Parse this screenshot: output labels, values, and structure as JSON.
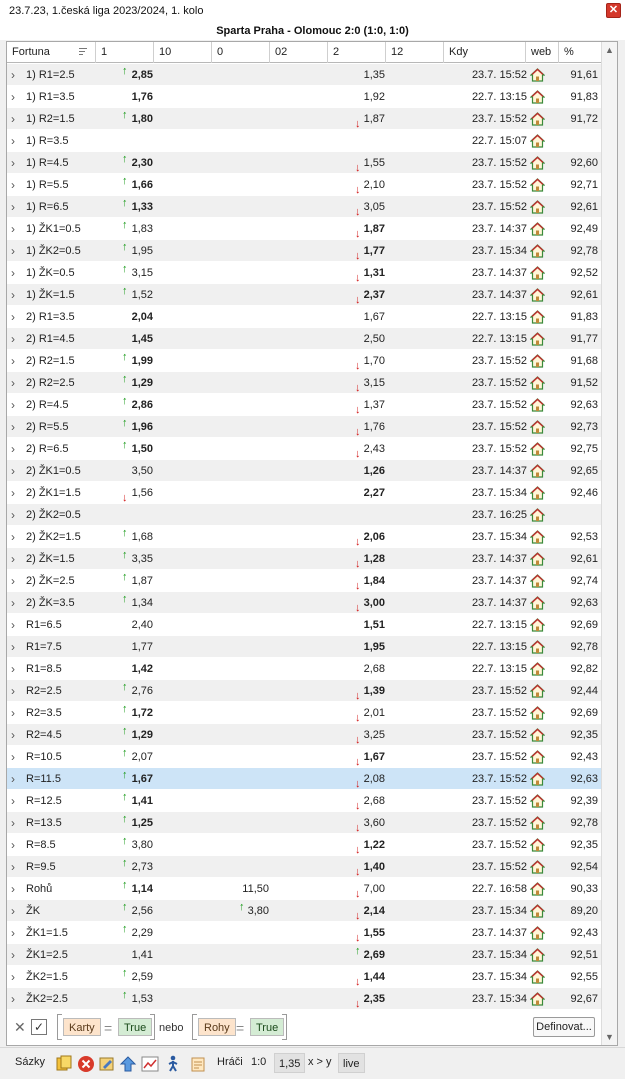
{
  "window": {
    "title": "23.7.23, 1.česká liga 2023/2024, 1. kolo",
    "close_label": "✕"
  },
  "match": {
    "title": "Sparta Praha - Olomouc 2:0 (1:0, 1:0)"
  },
  "columns": [
    "Fortuna",
    "1",
    "10",
    "0",
    "02",
    "2",
    "12",
    "Kdy",
    "web",
    "%"
  ],
  "rows": [
    {
      "name": "1) R1=2.5",
      "o1": "2,85",
      "o1b": true,
      "o1a": "up",
      "o10": "",
      "o10a": "",
      "o2": "1,35",
      "o2b": false,
      "o2a": "",
      "kdy": "23.7. 15:52",
      "pct": "91,61"
    },
    {
      "name": "1) R1=3.5",
      "o1": "1,76",
      "o1b": true,
      "o1a": "",
      "o10": "",
      "o10a": "",
      "o2": "1,92",
      "o2b": false,
      "o2a": "",
      "kdy": "22.7. 13:15",
      "pct": "91,83"
    },
    {
      "name": "1) R2=1.5",
      "o1": "1,80",
      "o1b": true,
      "o1a": "up",
      "o10": "",
      "o10a": "",
      "o2": "1,87",
      "o2b": false,
      "o2a": "down",
      "kdy": "23.7. 15:52",
      "pct": "91,72"
    },
    {
      "name": "1) R=3.5",
      "o1": "",
      "o1b": false,
      "o1a": "",
      "o10": "",
      "o10a": "",
      "o2": "",
      "o2b": false,
      "o2a": "",
      "kdy": "22.7. 15:07",
      "pct": ""
    },
    {
      "name": "1) R=4.5",
      "o1": "2,30",
      "o1b": true,
      "o1a": "up",
      "o10": "",
      "o10a": "",
      "o2": "1,55",
      "o2b": false,
      "o2a": "down",
      "kdy": "23.7. 15:52",
      "pct": "92,60"
    },
    {
      "name": "1) R=5.5",
      "o1": "1,66",
      "o1b": true,
      "o1a": "up",
      "o10": "",
      "o10a": "",
      "o2": "2,10",
      "o2b": false,
      "o2a": "down",
      "kdy": "23.7. 15:52",
      "pct": "92,71"
    },
    {
      "name": "1) R=6.5",
      "o1": "1,33",
      "o1b": true,
      "o1a": "up",
      "o10": "",
      "o10a": "",
      "o2": "3,05",
      "o2b": false,
      "o2a": "down",
      "kdy": "23.7. 15:52",
      "pct": "92,61"
    },
    {
      "name": "1) ŽK1=0.5",
      "o1": "1,83",
      "o1b": false,
      "o1a": "up",
      "o10": "",
      "o10a": "",
      "o2": "1,87",
      "o2b": true,
      "o2a": "down",
      "kdy": "23.7. 14:37",
      "pct": "92,49"
    },
    {
      "name": "1) ŽK2=0.5",
      "o1": "1,95",
      "o1b": false,
      "o1a": "up",
      "o10": "",
      "o10a": "",
      "o2": "1,77",
      "o2b": true,
      "o2a": "down",
      "kdy": "23.7. 15:34",
      "pct": "92,78"
    },
    {
      "name": "1) ŽK=0.5",
      "o1": "3,15",
      "o1b": false,
      "o1a": "up",
      "o10": "",
      "o10a": "",
      "o2": "1,31",
      "o2b": true,
      "o2a": "down",
      "kdy": "23.7. 14:37",
      "pct": "92,52"
    },
    {
      "name": "1) ŽK=1.5",
      "o1": "1,52",
      "o1b": false,
      "o1a": "up",
      "o10": "",
      "o10a": "",
      "o2": "2,37",
      "o2b": true,
      "o2a": "down",
      "kdy": "23.7. 14:37",
      "pct": "92,61"
    },
    {
      "name": "2) R1=3.5",
      "o1": "2,04",
      "o1b": true,
      "o1a": "",
      "o10": "",
      "o10a": "",
      "o2": "1,67",
      "o2b": false,
      "o2a": "",
      "kdy": "22.7. 13:15",
      "pct": "91,83"
    },
    {
      "name": "2) R1=4.5",
      "o1": "1,45",
      "o1b": true,
      "o1a": "",
      "o10": "",
      "o10a": "",
      "o2": "2,50",
      "o2b": false,
      "o2a": "",
      "kdy": "22.7. 13:15",
      "pct": "91,77"
    },
    {
      "name": "2) R2=1.5",
      "o1": "1,99",
      "o1b": true,
      "o1a": "up",
      "o10": "",
      "o10a": "",
      "o2": "1,70",
      "o2b": false,
      "o2a": "down",
      "kdy": "23.7. 15:52",
      "pct": "91,68"
    },
    {
      "name": "2) R2=2.5",
      "o1": "1,29",
      "o1b": true,
      "o1a": "up",
      "o10": "",
      "o10a": "",
      "o2": "3,15",
      "o2b": false,
      "o2a": "down",
      "kdy": "23.7. 15:52",
      "pct": "91,52"
    },
    {
      "name": "2) R=4.5",
      "o1": "2,86",
      "o1b": true,
      "o1a": "up",
      "o10": "",
      "o10a": "",
      "o2": "1,37",
      "o2b": false,
      "o2a": "down",
      "kdy": "23.7. 15:52",
      "pct": "92,63"
    },
    {
      "name": "2) R=5.5",
      "o1": "1,96",
      "o1b": true,
      "o1a": "up",
      "o10": "",
      "o10a": "",
      "o2": "1,76",
      "o2b": false,
      "o2a": "down",
      "kdy": "23.7. 15:52",
      "pct": "92,73"
    },
    {
      "name": "2) R=6.5",
      "o1": "1,50",
      "o1b": true,
      "o1a": "up",
      "o10": "",
      "o10a": "",
      "o2": "2,43",
      "o2b": false,
      "o2a": "down",
      "kdy": "23.7. 15:52",
      "pct": "92,75"
    },
    {
      "name": "2) ŽK1=0.5",
      "o1": "3,50",
      "o1b": false,
      "o1a": "",
      "o10": "",
      "o10a": "",
      "o2": "1,26",
      "o2b": true,
      "o2a": "",
      "kdy": "23.7. 14:37",
      "pct": "92,65"
    },
    {
      "name": "2) ŽK1=1.5",
      "o1": "1,56",
      "o1b": false,
      "o1a": "down",
      "o10": "",
      "o10a": "",
      "o2": "2,27",
      "o2b": true,
      "o2a": "",
      "kdy": "23.7. 15:34",
      "pct": "92,46"
    },
    {
      "name": "2) ŽK2=0.5",
      "o1": "",
      "o1b": false,
      "o1a": "",
      "o10": "",
      "o10a": "",
      "o2": "",
      "o2b": false,
      "o2a": "",
      "kdy": "23.7. 16:25",
      "pct": ""
    },
    {
      "name": "2) ŽK2=1.5",
      "o1": "1,68",
      "o1b": false,
      "o1a": "up",
      "o10": "",
      "o10a": "",
      "o2": "2,06",
      "o2b": true,
      "o2a": "down",
      "kdy": "23.7. 15:34",
      "pct": "92,53"
    },
    {
      "name": "2) ŽK=1.5",
      "o1": "3,35",
      "o1b": false,
      "o1a": "up",
      "o10": "",
      "o10a": "",
      "o2": "1,28",
      "o2b": true,
      "o2a": "down",
      "kdy": "23.7. 14:37",
      "pct": "92,61"
    },
    {
      "name": "2) ŽK=2.5",
      "o1": "1,87",
      "o1b": false,
      "o1a": "up",
      "o10": "",
      "o10a": "",
      "o2": "1,84",
      "o2b": true,
      "o2a": "down",
      "kdy": "23.7. 14:37",
      "pct": "92,74"
    },
    {
      "name": "2) ŽK=3.5",
      "o1": "1,34",
      "o1b": false,
      "o1a": "up",
      "o10": "",
      "o10a": "",
      "o2": "3,00",
      "o2b": true,
      "o2a": "down",
      "kdy": "23.7. 14:37",
      "pct": "92,63"
    },
    {
      "name": "R1=6.5",
      "o1": "2,40",
      "o1b": false,
      "o1a": "",
      "o10": "",
      "o10a": "",
      "o2": "1,51",
      "o2b": true,
      "o2a": "",
      "kdy": "22.7. 13:15",
      "pct": "92,69"
    },
    {
      "name": "R1=7.5",
      "o1": "1,77",
      "o1b": false,
      "o1a": "",
      "o10": "",
      "o10a": "",
      "o2": "1,95",
      "o2b": true,
      "o2a": "",
      "kdy": "22.7. 13:15",
      "pct": "92,78"
    },
    {
      "name": "R1=8.5",
      "o1": "1,42",
      "o1b": true,
      "o1a": "",
      "o10": "",
      "o10a": "",
      "o2": "2,68",
      "o2b": false,
      "o2a": "",
      "kdy": "22.7. 13:15",
      "pct": "92,82"
    },
    {
      "name": "R2=2.5",
      "o1": "2,76",
      "o1b": false,
      "o1a": "up",
      "o10": "",
      "o10a": "",
      "o2": "1,39",
      "o2b": true,
      "o2a": "down",
      "kdy": "23.7. 15:52",
      "pct": "92,44"
    },
    {
      "name": "R2=3.5",
      "o1": "1,72",
      "o1b": true,
      "o1a": "up",
      "o10": "",
      "o10a": "",
      "o2": "2,01",
      "o2b": false,
      "o2a": "down",
      "kdy": "23.7. 15:52",
      "pct": "92,69"
    },
    {
      "name": "R2=4.5",
      "o1": "1,29",
      "o1b": true,
      "o1a": "up",
      "o10": "",
      "o10a": "",
      "o2": "3,25",
      "o2b": false,
      "o2a": "down",
      "kdy": "23.7. 15:52",
      "pct": "92,35"
    },
    {
      "name": "R=10.5",
      "o1": "2,07",
      "o1b": false,
      "o1a": "up",
      "o10": "",
      "o10a": "",
      "o2": "1,67",
      "o2b": true,
      "o2a": "down",
      "kdy": "23.7. 15:52",
      "pct": "92,43"
    },
    {
      "name": "R=11.5",
      "o1": "1,67",
      "o1b": true,
      "o1a": "up",
      "o10": "",
      "o10a": "",
      "o2": "2,08",
      "o2b": false,
      "o2a": "down",
      "kdy": "23.7. 15:52",
      "pct": "92,63",
      "selected": true
    },
    {
      "name": "R=12.5",
      "o1": "1,41",
      "o1b": true,
      "o1a": "up",
      "o10": "",
      "o10a": "",
      "o2": "2,68",
      "o2b": false,
      "o2a": "down",
      "kdy": "23.7. 15:52",
      "pct": "92,39"
    },
    {
      "name": "R=13.5",
      "o1": "1,25",
      "o1b": true,
      "o1a": "up",
      "o10": "",
      "o10a": "",
      "o2": "3,60",
      "o2b": false,
      "o2a": "down",
      "kdy": "23.7. 15:52",
      "pct": "92,78"
    },
    {
      "name": "R=8.5",
      "o1": "3,80",
      "o1b": false,
      "o1a": "up",
      "o10": "",
      "o10a": "",
      "o2": "1,22",
      "o2b": true,
      "o2a": "down",
      "kdy": "23.7. 15:52",
      "pct": "92,35"
    },
    {
      "name": "R=9.5",
      "o1": "2,73",
      "o1b": false,
      "o1a": "up",
      "o10": "",
      "o10a": "",
      "o2": "1,40",
      "o2b": true,
      "o2a": "down",
      "kdy": "23.7. 15:52",
      "pct": "92,54"
    },
    {
      "name": "Rohů",
      "o1": "1,14",
      "o1b": true,
      "o1a": "up",
      "o10": "11,50",
      "o10a": "",
      "o2": "7,00",
      "o2b": false,
      "o2a": "down",
      "kdy": "22.7. 16:58",
      "pct": "90,33"
    },
    {
      "name": "ŽK",
      "o1": "2,56",
      "o1b": false,
      "o1a": "up",
      "o10": "3,80",
      "o10a": "up",
      "o2": "2,14",
      "o2b": true,
      "o2a": "down",
      "kdy": "23.7. 15:34",
      "pct": "89,20"
    },
    {
      "name": "ŽK1=1.5",
      "o1": "2,29",
      "o1b": false,
      "o1a": "up",
      "o10": "",
      "o10a": "",
      "o2": "1,55",
      "o2b": true,
      "o2a": "down",
      "kdy": "23.7. 14:37",
      "pct": "92,43"
    },
    {
      "name": "ŽK1=2.5",
      "o1": "1,41",
      "o1b": false,
      "o1a": "",
      "o10": "",
      "o10a": "",
      "o2": "2,69",
      "o2b": true,
      "o2a": "up",
      "kdy": "23.7. 15:34",
      "pct": "92,51"
    },
    {
      "name": "ŽK2=1.5",
      "o1": "2,59",
      "o1b": false,
      "o1a": "up",
      "o10": "",
      "o10a": "",
      "o2": "1,44",
      "o2b": true,
      "o2a": "down",
      "kdy": "23.7. 15:34",
      "pct": "92,55"
    },
    {
      "name": "ŽK2=2.5",
      "o1": "1,53",
      "o1b": false,
      "o1a": "up",
      "o10": "",
      "o10a": "",
      "o2": "2,35",
      "o2b": true,
      "o2a": "down",
      "kdy": "23.7. 15:34",
      "pct": "92,67"
    }
  ],
  "filter": {
    "clear_label": "✕",
    "check_label": "✓",
    "karty_label": "Karty",
    "true1_label": "True",
    "nebo_label": "nebo",
    "rohy_label": "Rohy",
    "true2_label": "True",
    "eq_label": "=",
    "define_label": "Definovat..."
  },
  "status": {
    "sazky_label": "Sázky",
    "hraci_label": "Hráči",
    "score": "1:0",
    "odds": "1,35",
    "cmp": "x > y",
    "live": "live"
  },
  "colors": {
    "up": "#1a9a1a",
    "down": "#d21a1a",
    "selected": "#cde4f7",
    "stripe": "#f0f0f0",
    "close": "#d4382b"
  },
  "icons": {
    "web": "house-icon",
    "arrow_up": "arrow-up-icon",
    "arrow_down": "arrow-down-icon"
  }
}
